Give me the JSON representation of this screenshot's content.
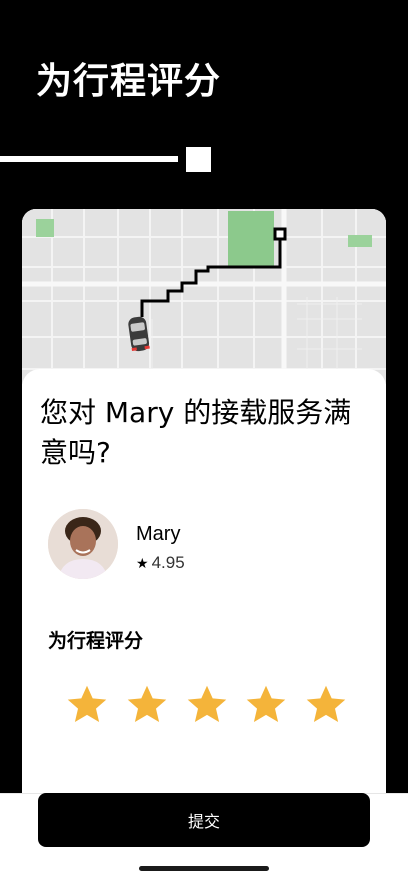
{
  "header": {
    "title": "为行程评分"
  },
  "progress": {
    "step_fraction": 0.5
  },
  "trip": {
    "question": "您对 Mary 的接载服务满意吗?"
  },
  "driver": {
    "name": "Mary",
    "rating": "4.95"
  },
  "rating_section": {
    "heading": "为行程评分",
    "stars_selected": 5,
    "stars_total": 5,
    "star_color": "#F4B43A"
  },
  "actions": {
    "submit_label": "提交"
  },
  "colors": {
    "background": "#000000",
    "map_background": "#e3e3e3",
    "map_park": "#8cc98c",
    "route": "#000000"
  }
}
